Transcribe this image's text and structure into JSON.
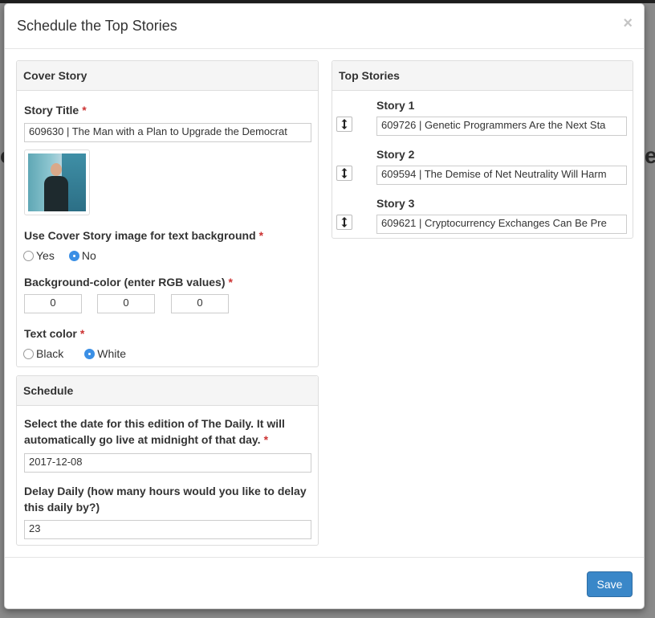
{
  "modal": {
    "title": "Schedule the Top Stories",
    "close_glyph": "×"
  },
  "cover_story": {
    "heading": "Cover Story",
    "story_title_label": "Story Title",
    "required_mark": "*",
    "story_title_value": "609630 | The Man with a Plan to Upgrade the Democrat",
    "use_image_label": "Use Cover Story image for text background",
    "use_image_options": [
      {
        "label": "Yes",
        "checked": false
      },
      {
        "label": "No",
        "checked": true
      }
    ],
    "bg_color_label": "Background-color (enter RGB values)",
    "bg_color_values": [
      "0",
      "0",
      "0"
    ],
    "text_color_label": "Text color",
    "text_color_options": [
      {
        "label": "Black",
        "checked": false
      },
      {
        "label": "White",
        "checked": true
      }
    ]
  },
  "schedule": {
    "heading": "Schedule",
    "date_label": "Select the date for this edition of The Daily. It will automatically go live at midnight of that day.",
    "date_value": "2017-12-08",
    "delay_label": "Delay Daily (how many hours would you like to delay this daily by?)",
    "delay_value": "23"
  },
  "top_stories": {
    "heading": "Top Stories",
    "stories": [
      {
        "label": "Story 1",
        "value": "609726 | Genetic Programmers Are the Next Sta"
      },
      {
        "label": "Story 2",
        "value": "609594 | The Demise of Net Neutrality Will Harm"
      },
      {
        "label": "Story 3",
        "value": "609621 | Cryptocurrency Exchanges Can Be Pre"
      }
    ]
  },
  "footer": {
    "save_label": "Save"
  },
  "colors": {
    "accent": "#3a87c8",
    "required": "#cc3333",
    "radio_checked": "#3b8fe5"
  },
  "icons": {
    "drag": "vertical-resize-arrow-icon",
    "close": "close-icon"
  }
}
